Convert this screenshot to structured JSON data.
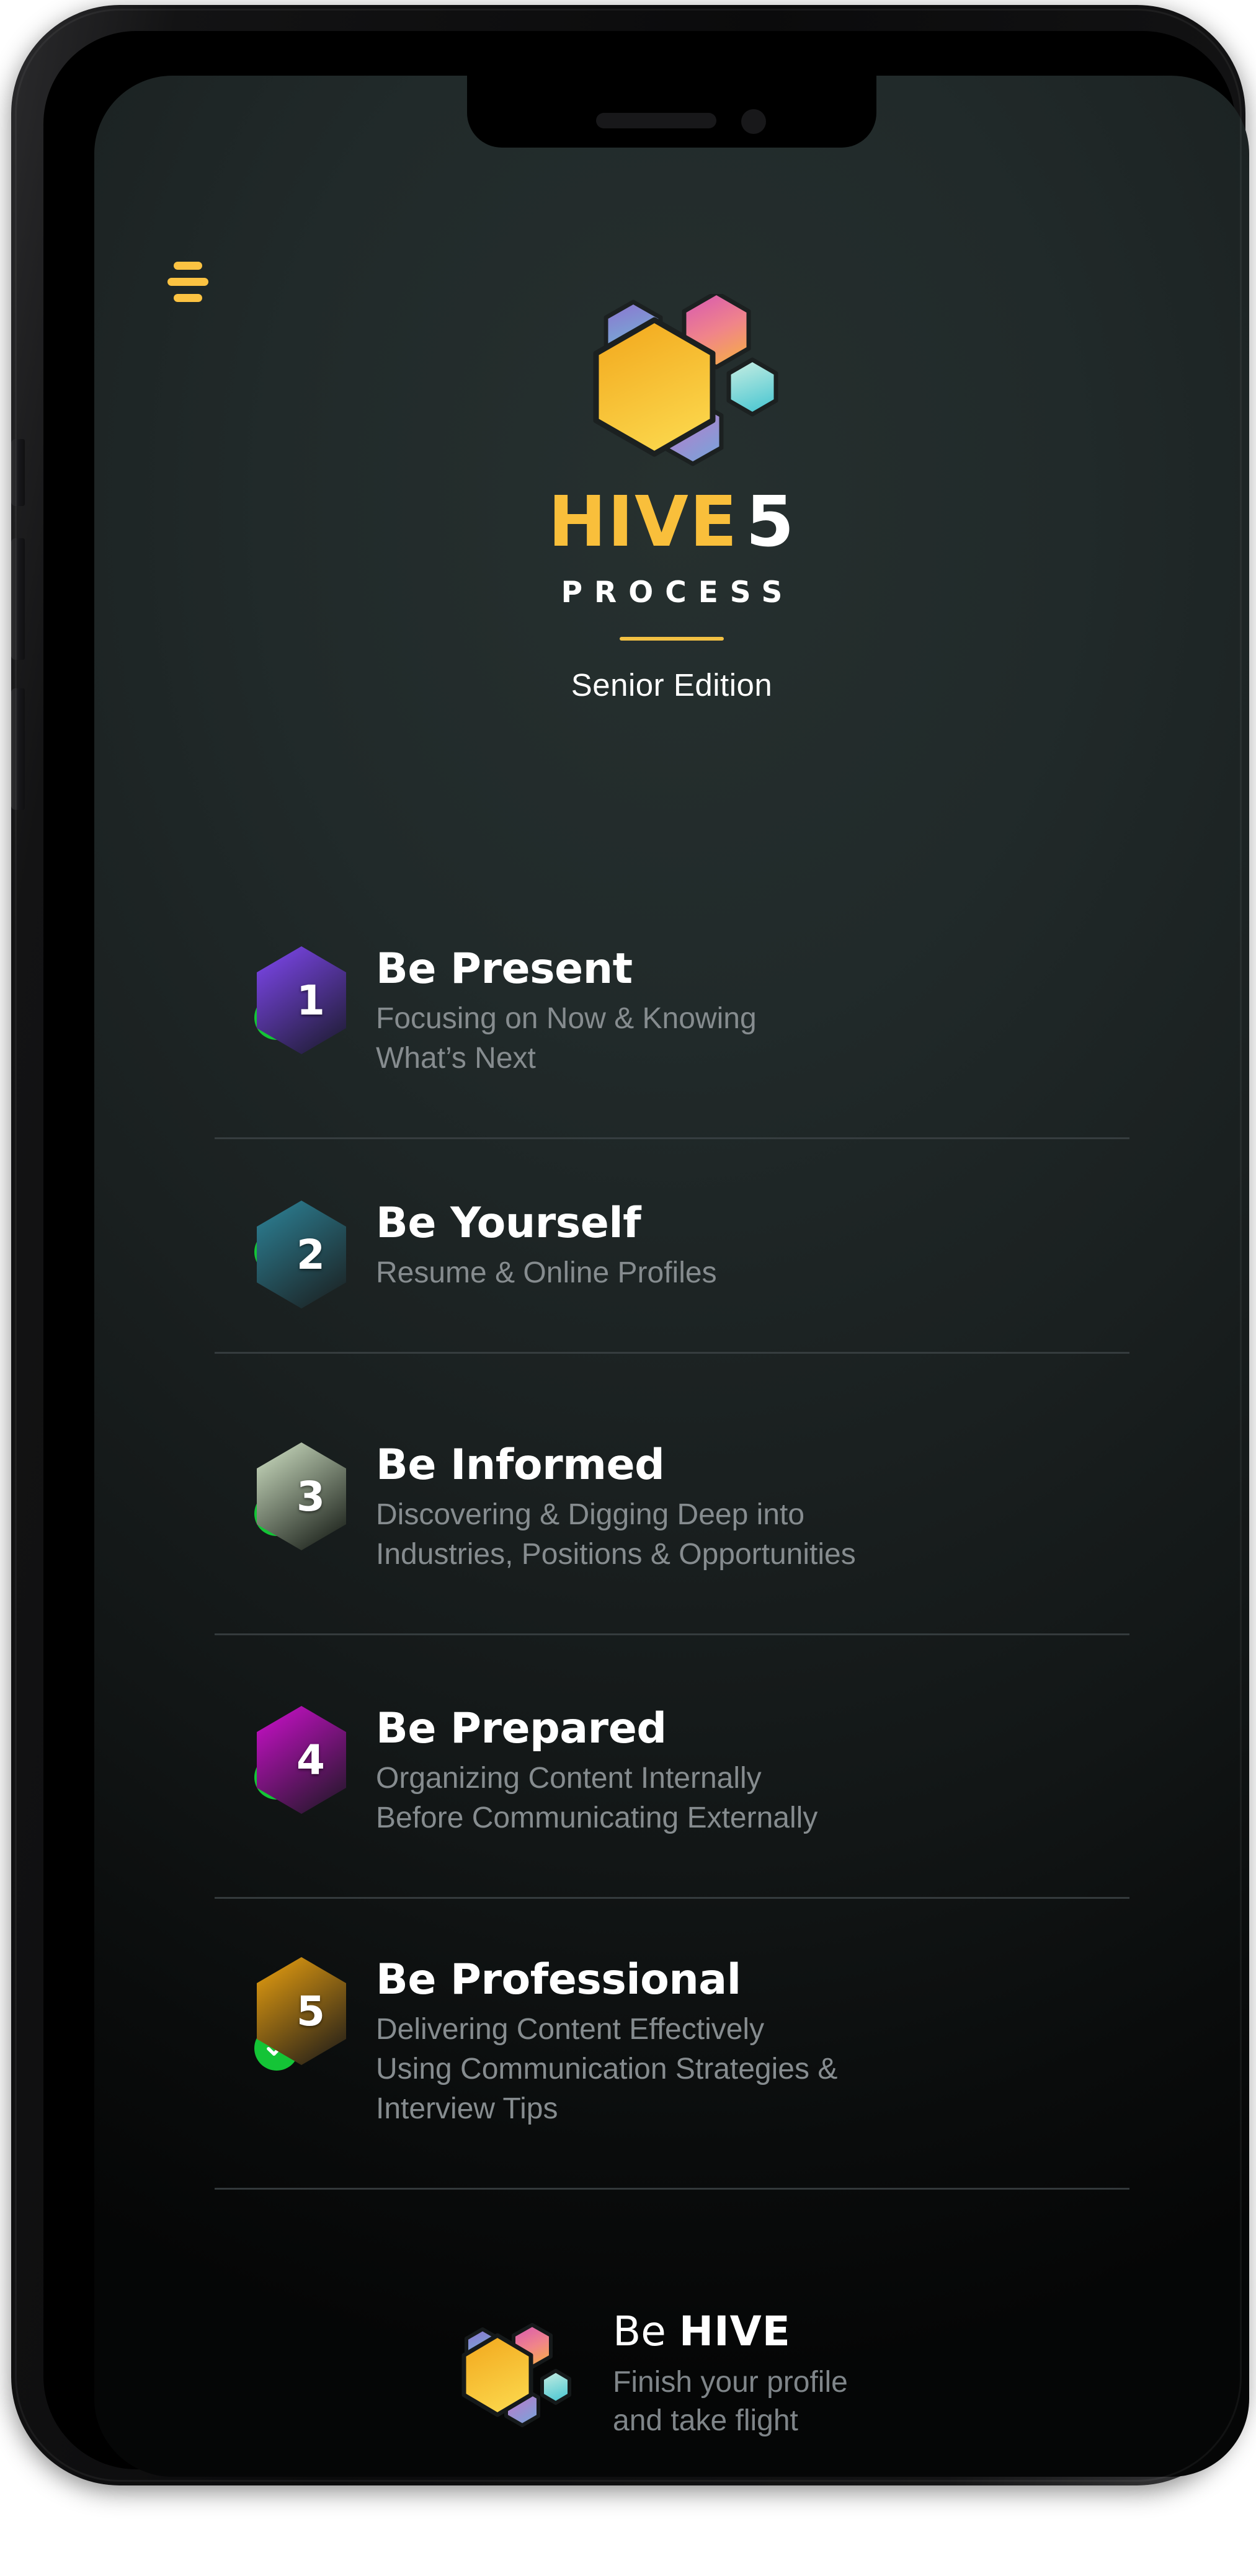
{
  "device": {
    "frame": "iphone-x-dark",
    "notch_speaker": "speaker-grille",
    "notch_camera": "front-camera"
  },
  "colors": {
    "screen_bg": "#1d2525",
    "accent_yellow": "#F9BF3B",
    "check_green": "#14C436",
    "title_white": "#FFFFFF",
    "subtitle_gray": "#868C8F",
    "divider_gray": "#3b4244"
  },
  "header": {
    "menu_icon": "hamburger-menu-icon",
    "logo_icon": "hive-hexagon-logo",
    "brand_name": "HIVE",
    "brand_number": "5",
    "brand_subtitle": "PROCESS",
    "edition": "Senior Edition"
  },
  "steps": [
    {
      "number": "1",
      "title": "Be Present",
      "subtitle": "Focusing on Now & Knowing\nWhat’s Next",
      "completed": true,
      "check_icon": "check-circle-icon",
      "hex_color_top": "#7B45E8",
      "hex_color_bottom": "#221E3A"
    },
    {
      "number": "2",
      "title": "Be Yourself",
      "subtitle": "Resume & Online Profiles",
      "completed": true,
      "check_icon": "check-circle-icon",
      "hex_color_top": "#2C7E92",
      "hex_color_bottom": "#1C2628"
    },
    {
      "number": "3",
      "title": "Be Informed",
      "subtitle": "Discovering & Digging Deep into\nIndustries, Positions & Opportunities",
      "completed": true,
      "check_icon": "check-circle-icon",
      "hex_color_top": "#C7D8BC",
      "hex_color_bottom": "#20261F"
    },
    {
      "number": "4",
      "title": "Be Prepared",
      "subtitle": "Organizing Content Internally\nBefore Communicating Externally",
      "completed": true,
      "check_icon": "check-circle-icon",
      "hex_color_top": "#C410C4",
      "hex_color_bottom": "#2A1730"
    },
    {
      "number": "5",
      "title": "Be Professional",
      "subtitle": "Delivering Content Effectively\nUsing Communication Strategies &\nInterview Tips",
      "completed": true,
      "check_icon": "check-circle-icon",
      "hex_color_top": "#E09A10",
      "hex_color_bottom": "#2B2418"
    }
  ],
  "footer": {
    "logo_icon": "hive-hexagon-logo-small",
    "title_prefix": "Be ",
    "title_brand": "HIVE",
    "subtitle": "Finish your profile\nand take flight"
  }
}
